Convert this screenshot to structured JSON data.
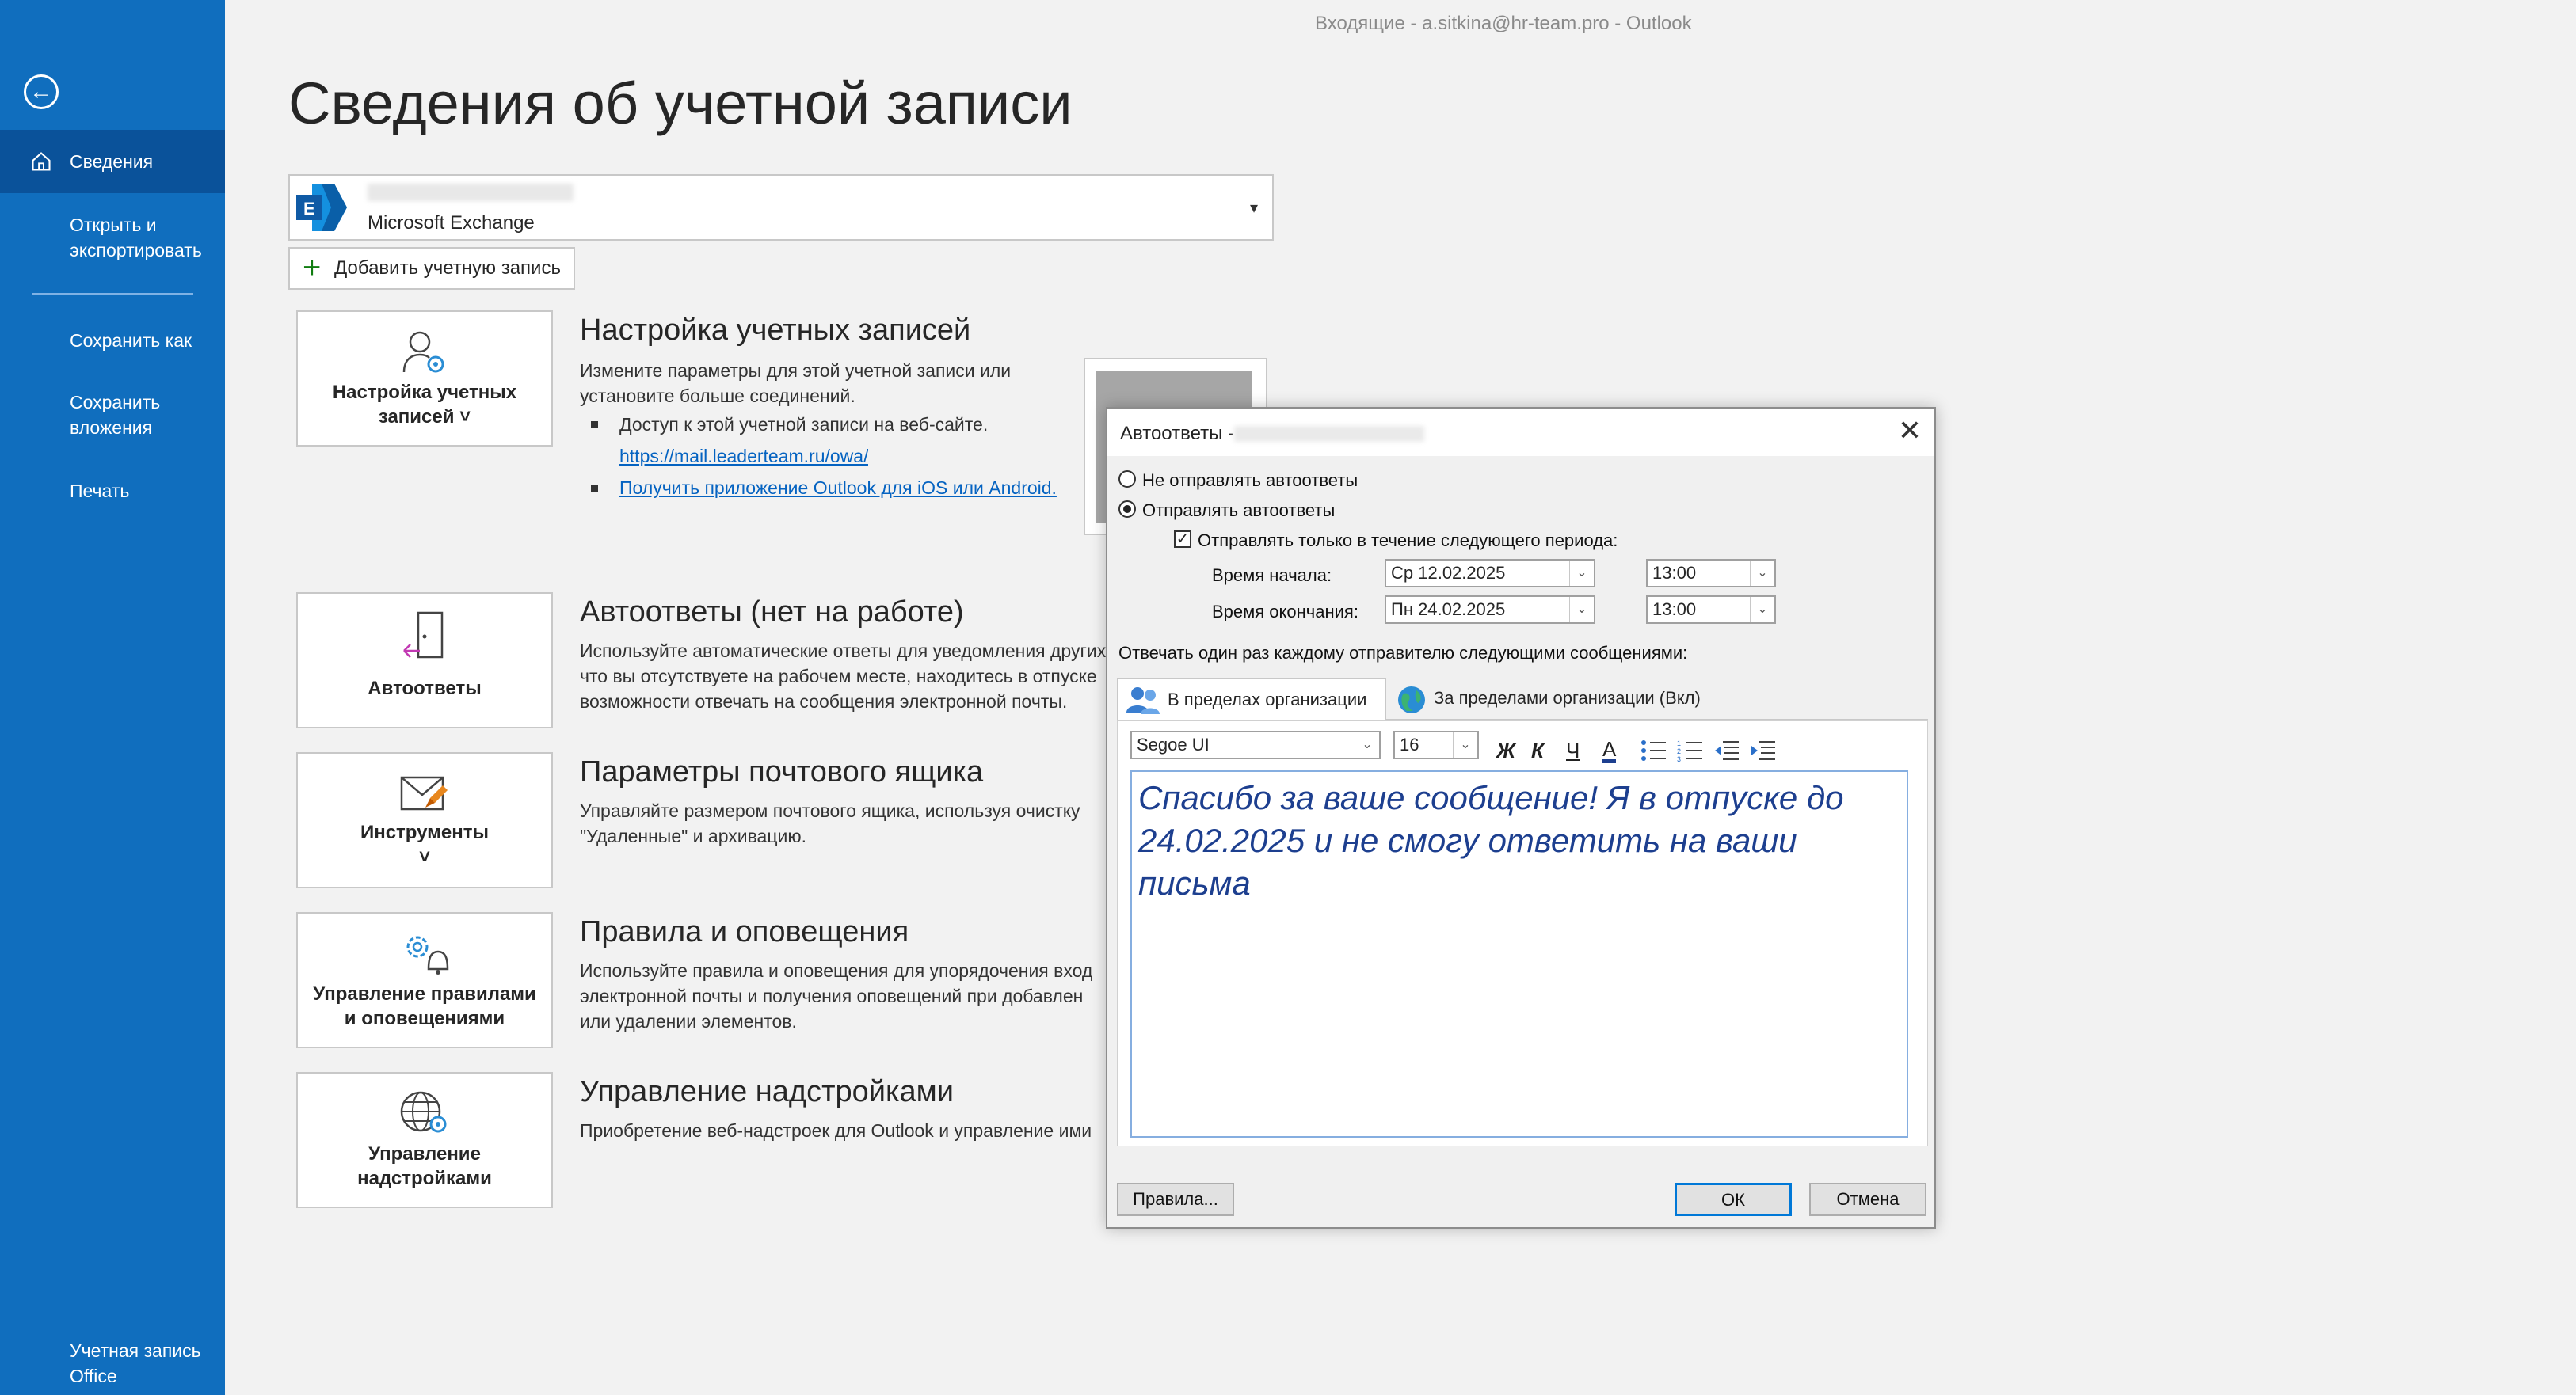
{
  "window": {
    "title": "Входящие - a.sitkina@hr-team.pro  -  Outlook"
  },
  "sidebar": {
    "back_icon": "back-arrow-icon",
    "items": [
      {
        "label": "Сведения",
        "icon": "home-icon"
      },
      {
        "label": "Открыть и\nэкспортировать"
      },
      {
        "label": "Сохранить как"
      },
      {
        "label": "Сохранить\nвложения"
      },
      {
        "label": "Печать"
      }
    ],
    "footer": "Учетная запись\nOffice"
  },
  "main": {
    "title": "Сведения об учетной записи",
    "account": {
      "type": "Microsoft Exchange",
      "icon": "exchange-icon"
    },
    "add_account": "Добавить учетную запись",
    "sections": [
      {
        "tile": "Настройка учетных\nзаписей ˅",
        "title": "Настройка учетных записей",
        "text": [
          "Измените параметры для этой учетной записи или",
          "установите больше соединений."
        ],
        "bullets": [
          "Доступ к этой учетной записи на веб-сайте."
        ],
        "link1": "https://mail.leaderteam.ru/owa/",
        "link2": "Получить приложение Outlook для iOS или Android."
      },
      {
        "tile": "Автоответы",
        "title": "Автоответы (нет на работе)",
        "text": [
          "Используйте автоматические ответы для уведомления других",
          "что вы отсутствуете на рабочем месте, находитесь в отпуске",
          "возможности отвечать на сообщения электронной почты."
        ]
      },
      {
        "tile": "Инструменты\n˅",
        "title": "Параметры почтового ящика",
        "text": [
          "Управляйте размером почтового ящика, используя очистку",
          "\"Удаленные\" и архивацию."
        ]
      },
      {
        "tile": "Управление правилами\nи оповещениями",
        "title": "Правила и оповещения",
        "text": [
          "Используйте правила и оповещения для упорядочения вход",
          "электронной почты и получения оповещений при добавлен",
          "или удалении элементов."
        ]
      },
      {
        "tile": "Управление\nнадстройками",
        "title": "Управление надстройками",
        "text": [
          "Приобретение веб-надстроек для Outlook и управление ими"
        ]
      }
    ]
  },
  "dialog": {
    "title": "Автоответы -",
    "radio_off": "Не отправлять автоответы",
    "radio_on": "Отправлять автоответы",
    "checkbox": "Отправлять только в течение следующего периода:",
    "start_label": "Время начала:",
    "start_date": "Ср 12.02.2025",
    "start_time": "13:00",
    "end_label": "Время окончания:",
    "end_date": "Пн 24.02.2025",
    "end_time": "13:00",
    "reply_note": "Отвечать один раз каждому отправителю следующими сообщениями:",
    "tab_inside": "В пределах организации",
    "tab_outside": "За пределами организации (Вкл)",
    "font": "Segoe UI",
    "size": "16",
    "fmt": {
      "bold": "Ж",
      "italic": "К",
      "underline": "Ч",
      "color": "A"
    },
    "message": "Спасибо за ваше сообщение! Я в отпуске до 24.02.2025 и не смогу ответить на ваши письма",
    "rules_btn": "Правила...",
    "ok_btn": "ОК",
    "cancel_btn": "Отмена"
  },
  "colors": {
    "sidebar": "#106ebe",
    "sidebar_active": "#0a529a",
    "link": "#0563c1",
    "message_text": "#1d3f8f"
  }
}
